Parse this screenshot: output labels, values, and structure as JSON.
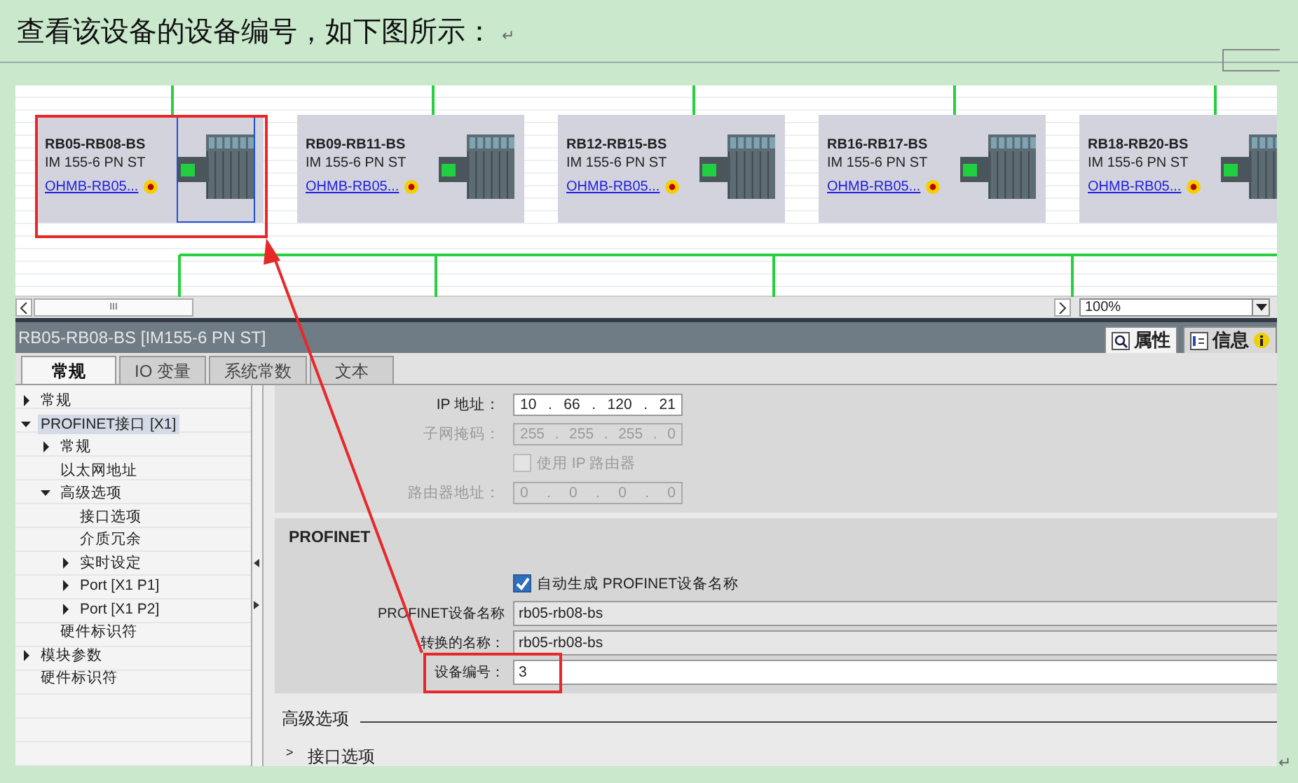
{
  "heading": {
    "text": "查看该设备的设备编号，如下图所示：",
    "mark": "↵"
  },
  "network": {
    "devices": [
      {
        "name": "RB05-RB08-BS",
        "type": "IM 155-6 PN ST",
        "link": "OHMB-RB05...",
        "selected": true
      },
      {
        "name": "RB09-RB11-BS",
        "type": "IM 155-6 PN ST",
        "link": "OHMB-RB05...",
        "selected": false
      },
      {
        "name": "RB12-RB15-BS",
        "type": "IM 155-6 PN ST",
        "link": "OHMB-RB05...",
        "selected": false
      },
      {
        "name": "RB16-RB17-BS",
        "type": "IM 155-6 PN ST",
        "link": "OHMB-RB05...",
        "selected": false
      },
      {
        "name": "RB18-RB20-BS",
        "type": "IM 155-6 PN ST",
        "link": "OHMB-RB05...",
        "selected": false
      }
    ],
    "scroll_grip": "III",
    "zoom": "100%"
  },
  "inspector": {
    "title": "RB05-RB08-BS [IM155-6 PN ST]",
    "side_tabs": [
      {
        "label": "属性",
        "selected": true
      },
      {
        "label": "信息",
        "selected": false
      }
    ],
    "tabs": [
      {
        "label": "常规",
        "selected": true
      },
      {
        "label": "IO 变量",
        "selected": false
      },
      {
        "label": "系统常数",
        "selected": false
      },
      {
        "label": "文本",
        "selected": false
      }
    ],
    "tree": [
      {
        "label": "常规",
        "expanded": false,
        "selected": false
      },
      {
        "label": "PROFINET接口 [X1]",
        "expanded": true,
        "selected": true,
        "children": [
          {
            "label": "常规",
            "expanded": false,
            "selected": false
          },
          {
            "label": "以太网地址",
            "selected": false
          },
          {
            "label": "高级选项",
            "expanded": true,
            "selected": false,
            "children": [
              {
                "label": "接口选项",
                "selected": false
              },
              {
                "label": "介质冗余",
                "selected": false
              },
              {
                "label": "实时设定",
                "expanded": false,
                "selected": false
              },
              {
                "label": "Port [X1 P1]",
                "expanded": false,
                "selected": false
              },
              {
                "label": "Port [X1 P2]",
                "expanded": false,
                "selected": false
              }
            ]
          },
          {
            "label": "硬件标识符",
            "selected": false
          }
        ]
      },
      {
        "label": "模块参数",
        "expanded": false,
        "selected": false
      },
      {
        "label": "硬件标识符",
        "selected": false
      }
    ],
    "ip_rows": [
      {
        "kind": "address",
        "label": "IP 地址：",
        "octets": [
          "10",
          "66",
          "120",
          "21"
        ],
        "separator": ".",
        "disabled": false
      },
      {
        "kind": "address",
        "label": "子网掩码：",
        "octets": [
          "255",
          "255",
          "255",
          "0"
        ],
        "separator": ".",
        "disabled": true
      },
      {
        "kind": "checkbox",
        "label": "使用 IP 路由器",
        "checked": false,
        "disabled": true
      },
      {
        "kind": "address",
        "label": "路由器地址：",
        "octets": [
          "0",
          "0",
          "0",
          "0"
        ],
        "separator": ".",
        "disabled": true
      }
    ],
    "profinet": {
      "title": "PROFINET",
      "rows": [
        {
          "kind": "checkbox",
          "label": "自动生成 PROFINET设备名称",
          "checked": true,
          "disabled": false
        },
        {
          "kind": "field",
          "label": "PROFINET设备名称",
          "value": "rb05-rb08-bs",
          "readonly": true
        },
        {
          "kind": "field",
          "label": "转换的名称：",
          "value": "rb05-rb08-bs",
          "readonly": true
        },
        {
          "kind": "field",
          "label": "设备编号：",
          "value": "3",
          "readonly": false
        }
      ]
    },
    "advanced": {
      "title": "高级选项",
      "first_item": "接口选项",
      "expander": ">"
    }
  },
  "end_mark": "↵"
}
